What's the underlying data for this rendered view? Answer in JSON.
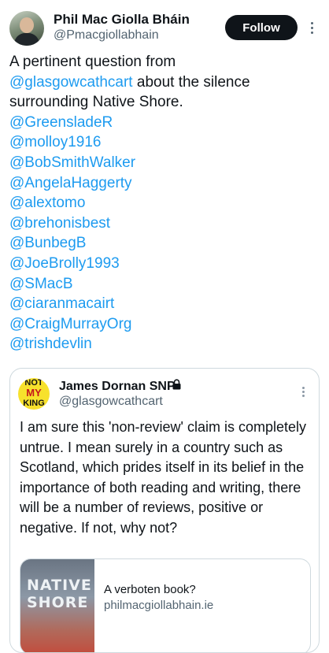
{
  "author": {
    "name": "Phil Mac Giolla Bháin",
    "handle": "@Pmacgiollabhain",
    "follow_label": "Follow"
  },
  "tweet": {
    "intro_text": "A pertinent question from",
    "quoted_mention": "@glasgowcathcart",
    "rest_text": " about the silence surrounding Native Shore.",
    "mentions": [
      "@GreensladeR",
      "@molloy1916",
      "@BobSmithWalker",
      "@AngelaHaggerty",
      "@alextomo",
      "@brehonisbest",
      "@BunbegB",
      "@JoeBrolly1993",
      "@SMacB",
      "@ciaranmacairt",
      "@CraigMurrayOrg",
      "@trishdevlin"
    ]
  },
  "quote": {
    "avatar_text": [
      "NOT",
      "MY",
      "KING"
    ],
    "name": "James Dornan SNP",
    "handle": "@glasgowcathcart",
    "text": "I am sure this 'non-review' claim is completely untrue. I mean surely in a country such as Scotland, which prides itself in its belief in the importance of both reading and writing, there will be a number of reviews, positive or negative. If not, why not?",
    "card": {
      "image_text": [
        "NATIVE",
        "SHORE"
      ],
      "title": "A verboten book?",
      "domain": "philmacgiollabhain.ie"
    }
  },
  "colors": {
    "link": "#1d9bf0",
    "follow_bg": "#0f1419",
    "secondary_text": "#536471"
  }
}
